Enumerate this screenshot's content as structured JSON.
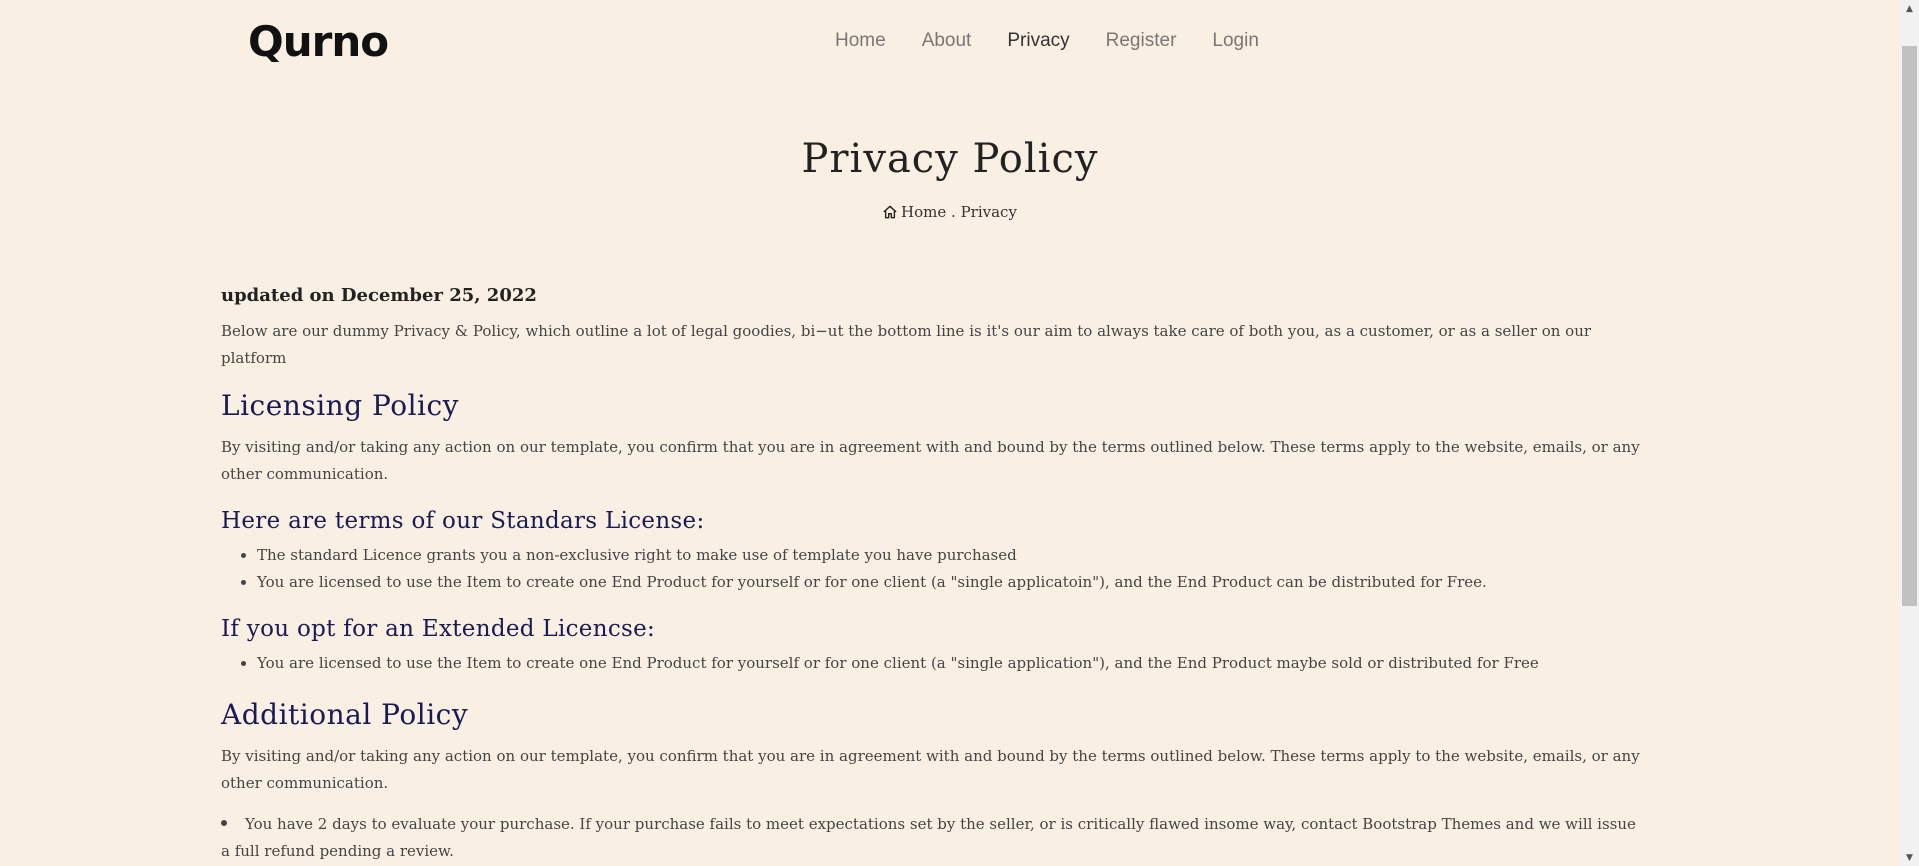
{
  "navbar": {
    "logo": "Qurno",
    "links": [
      {
        "label": "Home",
        "active": false
      },
      {
        "label": "About",
        "active": false
      },
      {
        "label": "Privacy",
        "active": true
      },
      {
        "label": "Register",
        "active": false
      },
      {
        "label": "Login",
        "active": false
      }
    ]
  },
  "hero": {
    "title": "Privacy Policy",
    "breadcrumb": {
      "home": "Home",
      "separator": " . ",
      "current": "Privacy",
      "icon": "home-icon"
    }
  },
  "content": {
    "updated": "updated on December 25, 2022",
    "intro": "Below are our dummy Privacy & Policy, which outline a lot of legal goodies, bi−ut the bottom line is it's our aim to always take care of both you, as a customer, or as a seller on our platform",
    "licensing": {
      "heading": "Licensing Policy",
      "text": "By visiting and/or taking any action on our template, you confirm that you are in agreement with and bound by the terms outlined below. These terms apply to the website, emails, or any other communication."
    },
    "standard": {
      "heading": "Here are terms of our Standars License:",
      "items": [
        "The standard Licence grants you a non-exclusive right to make use of template you have purchased",
        "You are licensed to use the Item to create one End Product for yourself or for one client (a \"single applicatoin\"), and the End Product can be distributed for Free."
      ]
    },
    "extended": {
      "heading": "If you opt for an Extended Licencse:",
      "items": [
        "You are licensed to use the Item to create one End Product for yourself or for one client (a \"single application\"), and the End Product maybe sold or distributed for Free"
      ]
    },
    "additional": {
      "heading": "Additional Policy",
      "text": "By visiting and/or taking any action on our template, you confirm that you are in agreement with and bound by the terms outlined below. These terms apply to the website, emails, or any other communication.",
      "bullet": "You have 2 days to evaluate your purchase. If your purchase fails to meet expectations set by the seller, or is critically flawed insome way, contact Bootstrap Themes and we will issue a full refund pending a review."
    }
  },
  "colors": {
    "background": "#f9f0e3",
    "heading": "#1a1a55",
    "text": "#444444"
  }
}
